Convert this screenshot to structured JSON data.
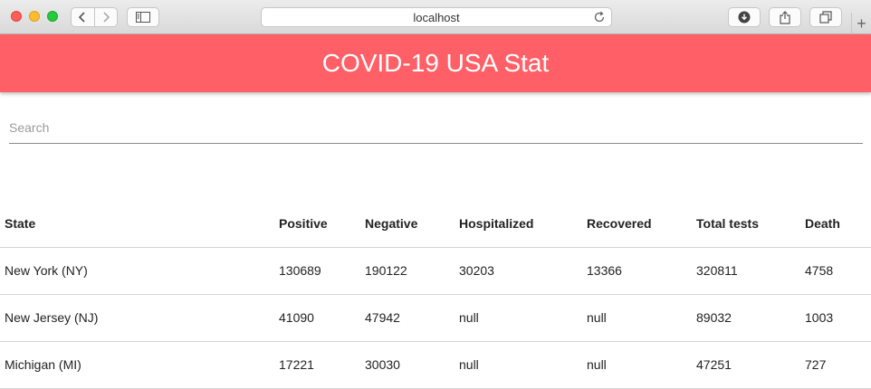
{
  "browser": {
    "address": "localhost",
    "newtab_label": "+"
  },
  "app": {
    "title": "COVID-19 USA Stat",
    "accent_color": "#ff5f66"
  },
  "search": {
    "placeholder": "Search",
    "value": ""
  },
  "table": {
    "headers": [
      "State",
      "Positive",
      "Negative",
      "Hospitalized",
      "Recovered",
      "Total tests",
      "Death"
    ],
    "rows": [
      [
        "New York (NY)",
        "130689",
        "190122",
        "30203",
        "13366",
        "320811",
        "4758"
      ],
      [
        "New Jersey (NJ)",
        "41090",
        "47942",
        "null",
        "null",
        "89032",
        "1003"
      ],
      [
        "Michigan (MI)",
        "17221",
        "30030",
        "null",
        "null",
        "47251",
        "727"
      ]
    ]
  }
}
